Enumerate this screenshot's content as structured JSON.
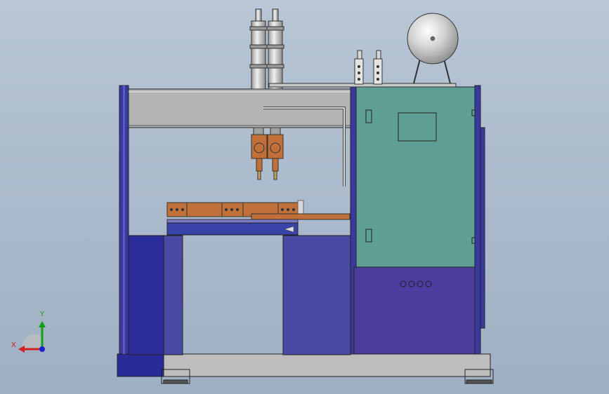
{
  "view": {
    "background_top": "#b8c6d6",
    "background_bottom": "#9fb0c4"
  },
  "machine": {
    "frame_color": "#3a3a9e",
    "panel_color": "#4848a0",
    "beam_color": "#b4b4b4",
    "cabinet_color": "#5f9e94",
    "cabinet_lower_color": "#4a3d9e",
    "electrode_color": "#c07038",
    "cylinder_color": "#c8c8c8",
    "tank_color": "#d0d0d0"
  },
  "triad": {
    "x_label": "X",
    "y_label": "Y",
    "x_color": "#d02020",
    "y_color": "#10a010",
    "z_color": "#2020d0"
  }
}
